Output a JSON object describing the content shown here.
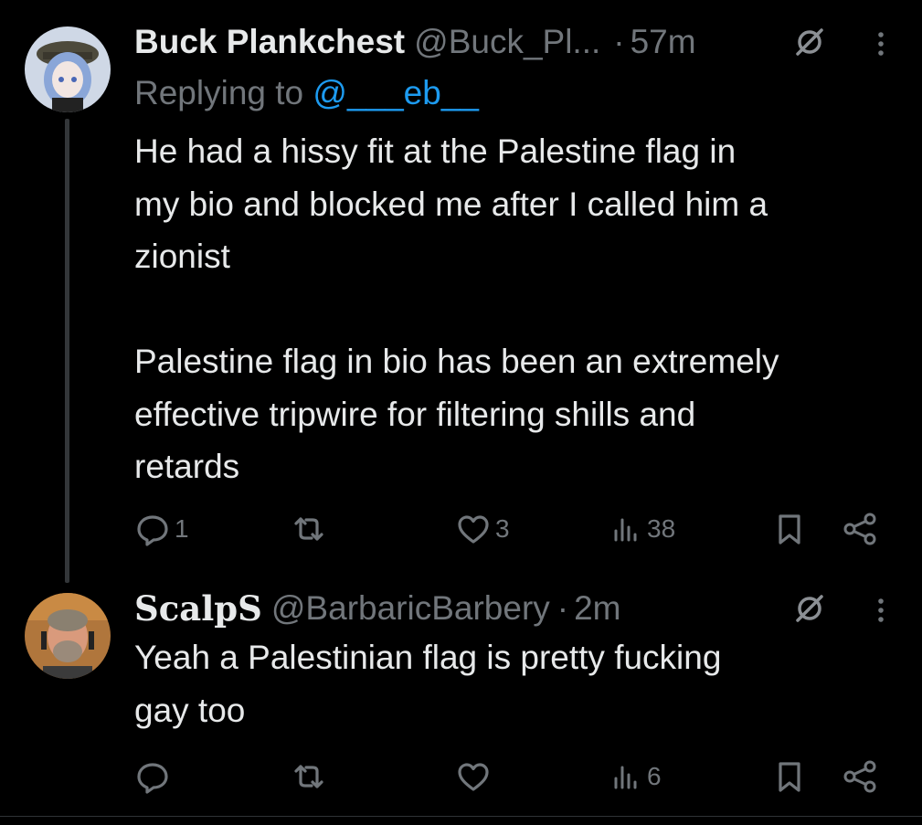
{
  "tweets": [
    {
      "display_name": "Buck Plankchest",
      "handle": "@Buck_Pl...",
      "separator": "·",
      "time": "57m",
      "reply_prefix": "Replying to ",
      "reply_handle": "@___eb__",
      "text": "He had a hissy fit at the Palestine flag in\nmy bio and blocked me after I called him a\nzionist\n\nPalestine flag in bio has been an extremely\neffective tripwire for filtering shills and\nretards",
      "replies": "1",
      "reposts": "",
      "likes": "3",
      "views": "38",
      "avatar": "anime-character-avatar",
      "icons": [
        "reply-icon",
        "repost-icon",
        "like-icon",
        "views-icon",
        "bookmark-icon",
        "share-icon",
        "null-badge-icon",
        "more-icon"
      ]
    },
    {
      "display_name": "ScalpS",
      "handle": "@BarbaricBarbery",
      "separator": "·",
      "time": "2m",
      "text": "Yeah a Palestinian flag is pretty fucking\ngay too",
      "replies": "",
      "reposts": "",
      "likes": "",
      "views": "6",
      "avatar": "man-with-headset-avatar"
    }
  ],
  "colors": {
    "background": "#000000",
    "text": "#e7e9ea",
    "muted": "#71767b",
    "link": "#1d9bf0",
    "thread_line": "#333639"
  }
}
